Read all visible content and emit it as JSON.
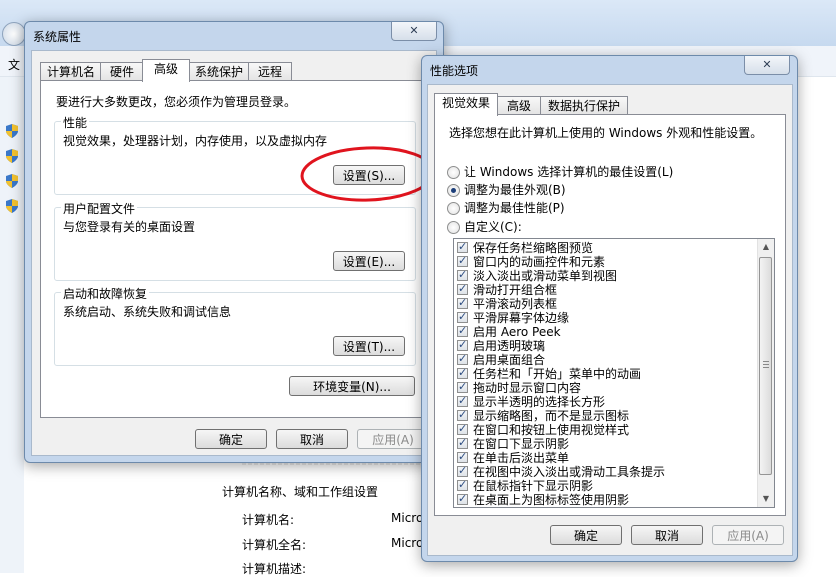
{
  "background": {
    "menu_label": "文",
    "section_title": "计算机名称、域和工作组设置",
    "rows": [
      {
        "label": "计算机名:",
        "value": "Micro"
      },
      {
        "label": "计算机全名:",
        "value": "Micro"
      },
      {
        "label": "计算机描述:",
        "value": ""
      }
    ]
  },
  "sysprops": {
    "title": "系统属性",
    "close_icon": "✕",
    "tabs": [
      "计算机名",
      "硬件",
      "高级",
      "系统保护",
      "远程"
    ],
    "active_tab": "高级",
    "admin_note": "要进行大多数更改，您必须作为管理员登录。",
    "groups": [
      {
        "title": "性能",
        "desc": "视觉效果，处理器计划，内存使用，以及虚拟内存",
        "button": "设置(S)..."
      },
      {
        "title": "用户配置文件",
        "desc": "与您登录有关的桌面设置",
        "button": "设置(E)..."
      },
      {
        "title": "启动和故障恢复",
        "desc": "系统启动、系统失败和调试信息",
        "button": "设置(T)..."
      }
    ],
    "env_button": "环境变量(N)...",
    "ok": "确定",
    "cancel": "取消",
    "apply": "应用(A)"
  },
  "perfopts": {
    "title": "性能选项",
    "close_icon": "✕",
    "tabs": [
      "视觉效果",
      "高级",
      "数据执行保护"
    ],
    "active_tab": "视觉效果",
    "intro": "选择您想在此计算机上使用的 Windows 外观和性能设置。",
    "radios": [
      {
        "label": "让 Windows 选择计算机的最佳设置(L)",
        "checked": false
      },
      {
        "label": "调整为最佳外观(B)",
        "checked": true
      },
      {
        "label": "调整为最佳性能(P)",
        "checked": false
      },
      {
        "label": "自定义(C):",
        "checked": false
      }
    ],
    "checklist": [
      "保存任务栏缩略图预览",
      "窗口内的动画控件和元素",
      "淡入淡出或滑动菜单到视图",
      "滑动打开组合框",
      "平滑滚动列表框",
      "平滑屏幕字体边缘",
      "启用 Aero Peek",
      "启用透明玻璃",
      "启用桌面组合",
      "任务栏和「开始」菜单中的动画",
      "拖动时显示窗口内容",
      "显示半透明的选择长方形",
      "显示缩略图，而不是显示图标",
      "在窗口和按钮上使用视觉样式",
      "在窗口下显示阴影",
      "在单击后淡出菜单",
      "在视图中淡入淡出或滑动工具条提示",
      "在鼠标指针下显示阴影",
      "在桌面上为图标标签使用阴影"
    ],
    "scroll_up_icon": "▲",
    "scroll_down_icon": "▼",
    "ok": "确定",
    "cancel": "取消",
    "apply": "应用(A)"
  },
  "colors": {
    "annotation": "#e0141e",
    "window_frame": "#c4d6ec"
  }
}
